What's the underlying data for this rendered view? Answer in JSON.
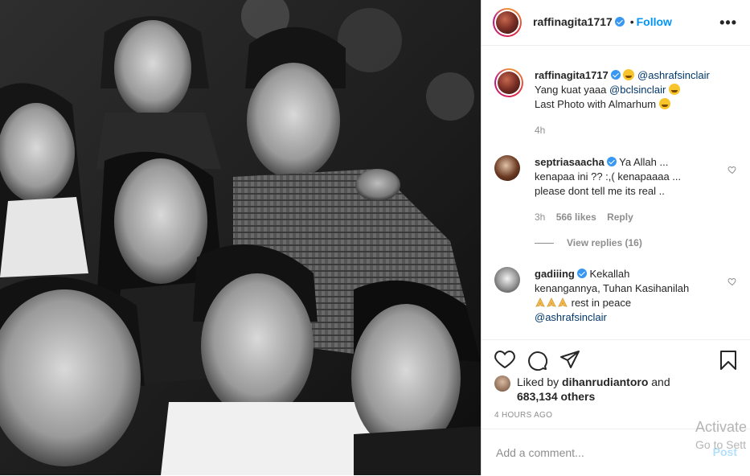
{
  "post": {
    "author": "raffinagita1717",
    "follow_label": "Follow",
    "separator": "•",
    "more_icon": "•••"
  },
  "caption": {
    "username": "raffinagita1717",
    "mention_1": "@ashrafsinclair",
    "line_2_text": "Yang kuat yaaa",
    "mention_2": "@bclsinclair",
    "line_3_text": "Last Photo with Almarhum",
    "time": "4h"
  },
  "comments": [
    {
      "username": "septriasaacha",
      "line_1": "Ya Allah ...",
      "line_2": "kenapaa ini ?? :,( kenapaaaa ...",
      "line_3": "please dont tell me its real ..",
      "time": "3h",
      "likes": "566 likes",
      "reply_label": "Reply",
      "view_replies": "View replies (16)"
    },
    {
      "username": "gadiiing",
      "line_1": "Kekallah",
      "line_2": "kenangannya, Tuhan Kasihanilah",
      "line_3_text": "rest in peace",
      "mention": "@ashrafsinclair"
    }
  ],
  "likes": {
    "prefix": "Liked by ",
    "user": "dihanrudiantoro",
    "middle": " and",
    "count": "683,134 others"
  },
  "timestamp": "4 HOURS AGO",
  "add_comment": {
    "placeholder": "Add a comment...",
    "post_label": "Post"
  },
  "watermark": {
    "line_1": "Activate",
    "line_2": "Go to Sett"
  },
  "colors": {
    "link": "#0095f6",
    "mention": "#00376b",
    "muted": "#8e8e8e",
    "verified": "#3897f0"
  },
  "icons": [
    "heart-icon",
    "comment-icon",
    "share-icon",
    "bookmark-icon",
    "verified-icon",
    "more-icon"
  ]
}
